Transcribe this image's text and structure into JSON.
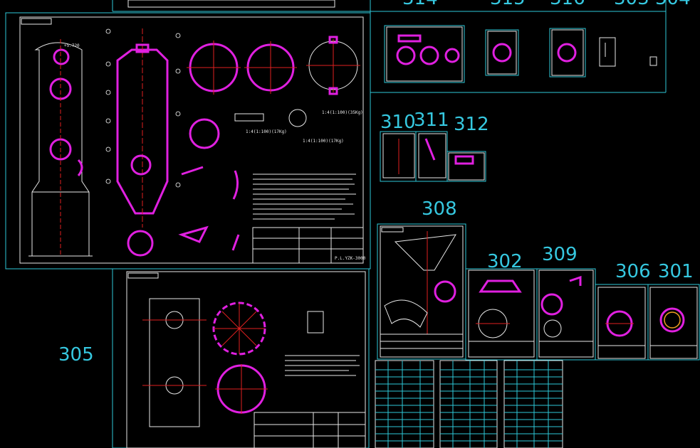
{
  "labels": {
    "l305": "305",
    "l308": "308",
    "l310": "310",
    "l311": "311",
    "l312": "312",
    "l302": "302",
    "l309": "309",
    "l306": "306",
    "l301": "301"
  },
  "colors": {
    "frame": "#2ec8d8",
    "magenta": "#e020e0",
    "red": "#e02020",
    "white": "#e8e8e8",
    "background": "#000000"
  }
}
